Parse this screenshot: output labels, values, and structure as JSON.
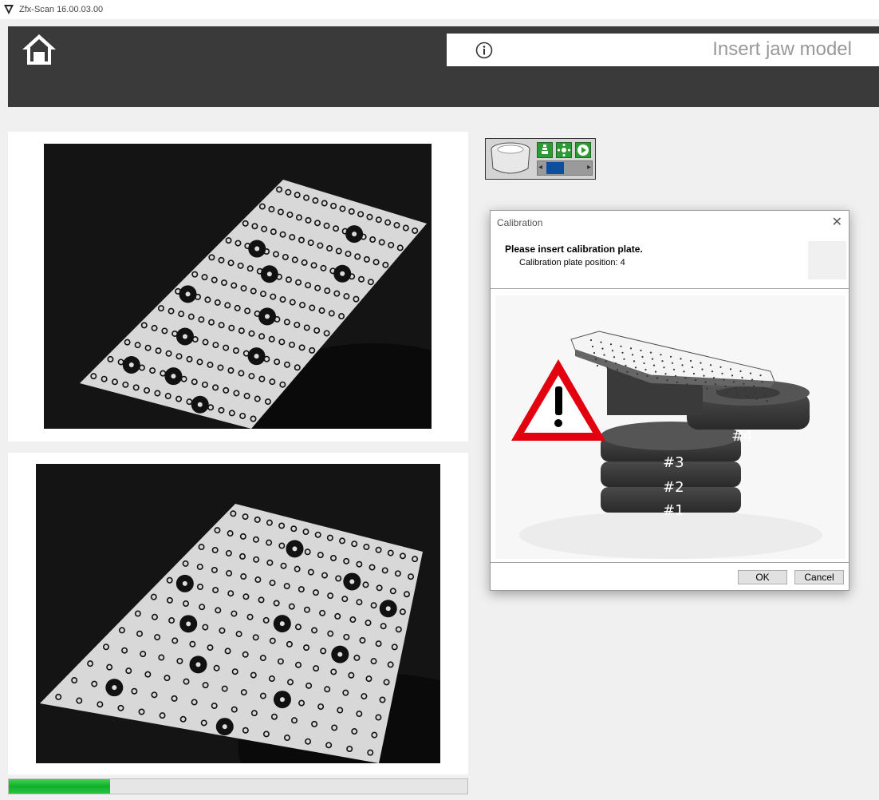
{
  "window": {
    "title": "Zfx-Scan 16.00.03.00"
  },
  "header": {
    "title": "Insert jaw model"
  },
  "progress": {
    "fraction": 0.22
  },
  "dialog": {
    "title": "Calibration",
    "heading": "Please insert calibration plate.",
    "subtext": "Calibration plate position: 4",
    "ok_label": "OK",
    "cancel_label": "Cancel",
    "image_labels": [
      "#4",
      "#3",
      "#2",
      "#1"
    ]
  },
  "icons": [
    "app-logo-icon",
    "home-icon",
    "info-icon",
    "close-icon",
    "warning-icon"
  ],
  "colors": {
    "header_bg": "#3a3a3a",
    "progress_green": "#10b02c",
    "scroll_thumb": "#0d4f9e",
    "warning_red": "#e3000f"
  }
}
